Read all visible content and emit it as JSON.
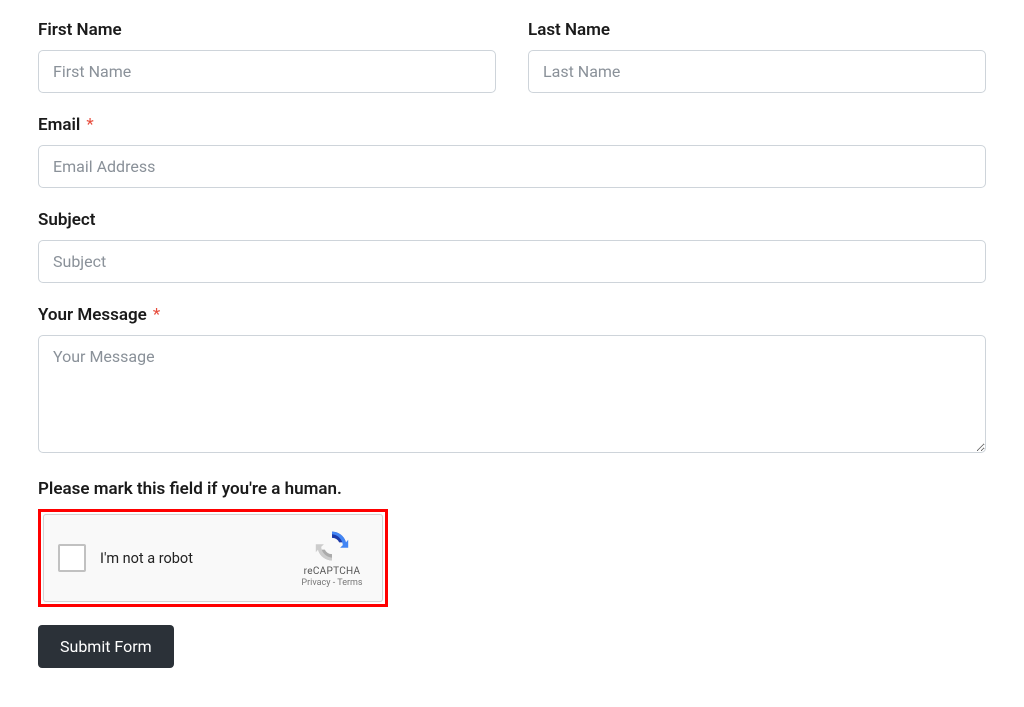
{
  "firstName": {
    "label": "First Name",
    "placeholder": "First Name"
  },
  "lastName": {
    "label": "Last Name",
    "placeholder": "Last Name"
  },
  "email": {
    "label": "Email",
    "placeholder": "Email Address",
    "requiredMark": "*"
  },
  "subject": {
    "label": "Subject",
    "placeholder": "Subject"
  },
  "message": {
    "label": "Your Message",
    "placeholder": "Your Message",
    "requiredMark": "*"
  },
  "captcha": {
    "label": "Please mark this field if you're a human.",
    "notRobot": "I'm not a robot",
    "brand": "reCAPTCHA",
    "links": "Privacy - Terms"
  },
  "submit": {
    "label": "Submit Form"
  }
}
